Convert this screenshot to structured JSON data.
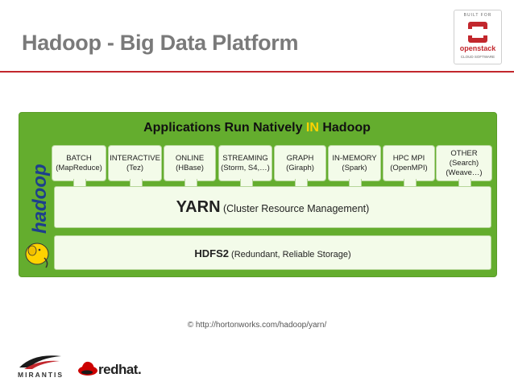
{
  "slide": {
    "title": "Hadoop - Big Data Platform",
    "accent_color": "#c2272d"
  },
  "badge": {
    "built_for": "BUILT FOR",
    "name": "openstack",
    "subtitle": "CLOUD SOFTWARE",
    "icon": "openstack-logo-icon"
  },
  "diagram": {
    "title_prefix": "Applications Run Natively ",
    "title_highlight": "IN",
    "title_suffix": " Hadoop",
    "background_color": "#64ad2e",
    "highlight_color": "#ffd200",
    "side_logo": {
      "text": "hadoop",
      "icon": "hadoop-elephant-icon"
    },
    "apps": [
      {
        "line1": "BATCH",
        "line2": "(MapReduce)",
        "line3": ""
      },
      {
        "line1": "INTERACTIVE",
        "line2": "(Tez)",
        "line3": ""
      },
      {
        "line1": "ONLINE",
        "line2": "(HBase)",
        "line3": ""
      },
      {
        "line1": "STREAMING",
        "line2": "(Storm, S4,…)",
        "line3": ""
      },
      {
        "line1": "GRAPH",
        "line2": "(Giraph)",
        "line3": ""
      },
      {
        "line1": "IN-MEMORY",
        "line2": "(Spark)",
        "line3": ""
      },
      {
        "line1": "HPC MPI",
        "line2": "(OpenMPI)",
        "line3": ""
      },
      {
        "line1": "OTHER",
        "line2": "(Search)",
        "line3": "(Weave…)"
      }
    ],
    "yarn": {
      "name": "YARN",
      "desc": " (Cluster Resource Management)"
    },
    "hdfs": {
      "name": "HDFS2",
      "desc": " (Redundant, Reliable Storage)"
    }
  },
  "credit": "© http://hortonworks.com/hadoop/yarn/",
  "footer": {
    "mirantis": "MIRANTIS",
    "redhat": "redhat."
  }
}
